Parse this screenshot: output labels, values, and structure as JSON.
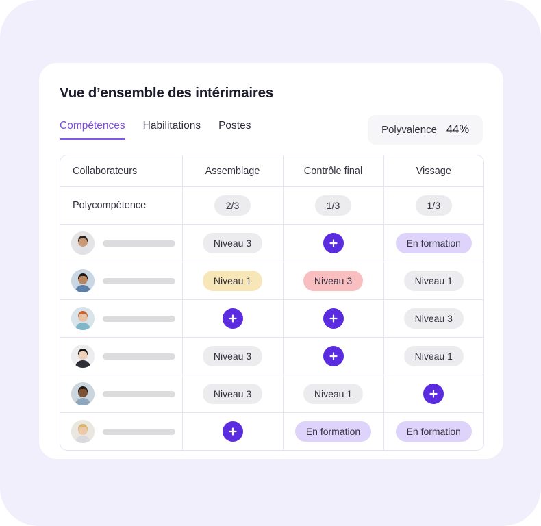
{
  "card": {
    "title": "Vue d’ensemble des intérimaires"
  },
  "tabs": [
    {
      "label": "Compétences",
      "active": true
    },
    {
      "label": "Habilitations",
      "active": false
    },
    {
      "label": "Postes",
      "active": false
    }
  ],
  "polyvalence": {
    "label": "Polyvalence",
    "value": "44%"
  },
  "table": {
    "headers": [
      "Collaborateurs",
      "Assemblage",
      "Contrôle final",
      "Vissage"
    ],
    "summary_row": {
      "label": "Polycompétence",
      "values": [
        "2/3",
        "1/3",
        "1/3"
      ]
    },
    "rows": [
      {
        "avatar": "avatar-person-1",
        "name_redacted": true,
        "cells": [
          {
            "type": "chip",
            "style": "grey",
            "text": "Niveau 3"
          },
          {
            "type": "add",
            "style": "plus",
            "text": "+"
          },
          {
            "type": "chip",
            "style": "purple",
            "text": "En formation"
          }
        ]
      },
      {
        "avatar": "avatar-person-2",
        "name_redacted": true,
        "cells": [
          {
            "type": "chip",
            "style": "yellow",
            "text": "Niveau 1"
          },
          {
            "type": "chip",
            "style": "pink",
            "text": "Niveau 3"
          },
          {
            "type": "chip",
            "style": "grey",
            "text": "Niveau 1"
          }
        ]
      },
      {
        "avatar": "avatar-person-3",
        "name_redacted": true,
        "cells": [
          {
            "type": "add",
            "style": "plus",
            "text": "+"
          },
          {
            "type": "add",
            "style": "plus",
            "text": "+"
          },
          {
            "type": "chip",
            "style": "grey",
            "text": "Niveau 3"
          }
        ]
      },
      {
        "avatar": "avatar-person-4",
        "name_redacted": true,
        "cells": [
          {
            "type": "chip",
            "style": "grey",
            "text": "Niveau 3"
          },
          {
            "type": "add",
            "style": "plus",
            "text": "+"
          },
          {
            "type": "chip",
            "style": "grey",
            "text": "Niveau 1"
          }
        ]
      },
      {
        "avatar": "avatar-person-5",
        "name_redacted": true,
        "cells": [
          {
            "type": "chip",
            "style": "grey",
            "text": "Niveau 3"
          },
          {
            "type": "chip",
            "style": "grey",
            "text": "Niveau 1"
          },
          {
            "type": "add",
            "style": "plus",
            "text": "+"
          }
        ]
      },
      {
        "avatar": "avatar-person-6",
        "name_redacted": true,
        "cells": [
          {
            "type": "add",
            "style": "plus",
            "text": "+"
          },
          {
            "type": "chip",
            "style": "purple",
            "text": "En formation"
          },
          {
            "type": "chip",
            "style": "purple",
            "text": "En formation"
          }
        ]
      }
    ]
  },
  "colors": {
    "background": "#F1EFFC",
    "card": "#FFFFFF",
    "accent": "#5B2BE0",
    "tab_active": "#7B4CE0",
    "chip_grey": "#ECECEF",
    "chip_yellow": "#F7E6B8",
    "chip_pink": "#F8BEC0",
    "chip_purple": "#DED3FA",
    "border": "#E6E4F2"
  }
}
